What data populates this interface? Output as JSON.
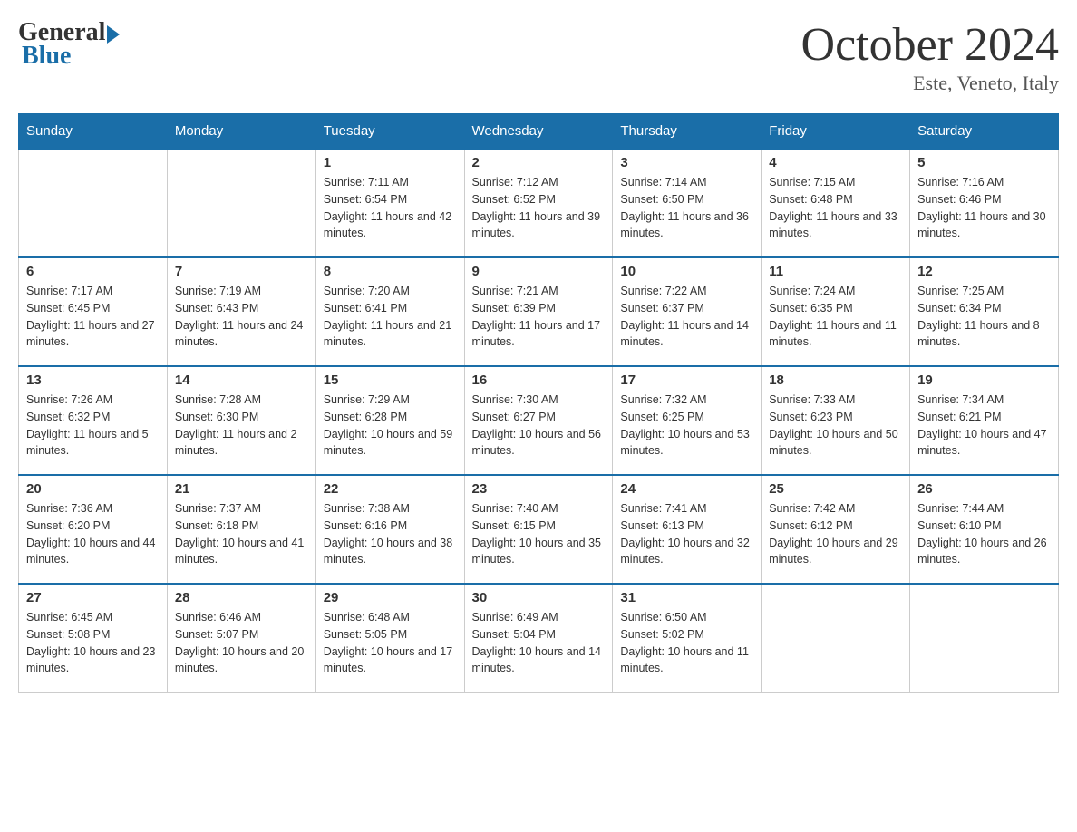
{
  "header": {
    "logo_general": "General",
    "logo_blue": "Blue",
    "month_title": "October 2024",
    "location": "Este, Veneto, Italy"
  },
  "days_of_week": [
    "Sunday",
    "Monday",
    "Tuesday",
    "Wednesday",
    "Thursday",
    "Friday",
    "Saturday"
  ],
  "weeks": [
    [
      {
        "day": "",
        "sunrise": "",
        "sunset": "",
        "daylight": ""
      },
      {
        "day": "",
        "sunrise": "",
        "sunset": "",
        "daylight": ""
      },
      {
        "day": "1",
        "sunrise": "Sunrise: 7:11 AM",
        "sunset": "Sunset: 6:54 PM",
        "daylight": "Daylight: 11 hours and 42 minutes."
      },
      {
        "day": "2",
        "sunrise": "Sunrise: 7:12 AM",
        "sunset": "Sunset: 6:52 PM",
        "daylight": "Daylight: 11 hours and 39 minutes."
      },
      {
        "day": "3",
        "sunrise": "Sunrise: 7:14 AM",
        "sunset": "Sunset: 6:50 PM",
        "daylight": "Daylight: 11 hours and 36 minutes."
      },
      {
        "day": "4",
        "sunrise": "Sunrise: 7:15 AM",
        "sunset": "Sunset: 6:48 PM",
        "daylight": "Daylight: 11 hours and 33 minutes."
      },
      {
        "day": "5",
        "sunrise": "Sunrise: 7:16 AM",
        "sunset": "Sunset: 6:46 PM",
        "daylight": "Daylight: 11 hours and 30 minutes."
      }
    ],
    [
      {
        "day": "6",
        "sunrise": "Sunrise: 7:17 AM",
        "sunset": "Sunset: 6:45 PM",
        "daylight": "Daylight: 11 hours and 27 minutes."
      },
      {
        "day": "7",
        "sunrise": "Sunrise: 7:19 AM",
        "sunset": "Sunset: 6:43 PM",
        "daylight": "Daylight: 11 hours and 24 minutes."
      },
      {
        "day": "8",
        "sunrise": "Sunrise: 7:20 AM",
        "sunset": "Sunset: 6:41 PM",
        "daylight": "Daylight: 11 hours and 21 minutes."
      },
      {
        "day": "9",
        "sunrise": "Sunrise: 7:21 AM",
        "sunset": "Sunset: 6:39 PM",
        "daylight": "Daylight: 11 hours and 17 minutes."
      },
      {
        "day": "10",
        "sunrise": "Sunrise: 7:22 AM",
        "sunset": "Sunset: 6:37 PM",
        "daylight": "Daylight: 11 hours and 14 minutes."
      },
      {
        "day": "11",
        "sunrise": "Sunrise: 7:24 AM",
        "sunset": "Sunset: 6:35 PM",
        "daylight": "Daylight: 11 hours and 11 minutes."
      },
      {
        "day": "12",
        "sunrise": "Sunrise: 7:25 AM",
        "sunset": "Sunset: 6:34 PM",
        "daylight": "Daylight: 11 hours and 8 minutes."
      }
    ],
    [
      {
        "day": "13",
        "sunrise": "Sunrise: 7:26 AM",
        "sunset": "Sunset: 6:32 PM",
        "daylight": "Daylight: 11 hours and 5 minutes."
      },
      {
        "day": "14",
        "sunrise": "Sunrise: 7:28 AM",
        "sunset": "Sunset: 6:30 PM",
        "daylight": "Daylight: 11 hours and 2 minutes."
      },
      {
        "day": "15",
        "sunrise": "Sunrise: 7:29 AM",
        "sunset": "Sunset: 6:28 PM",
        "daylight": "Daylight: 10 hours and 59 minutes."
      },
      {
        "day": "16",
        "sunrise": "Sunrise: 7:30 AM",
        "sunset": "Sunset: 6:27 PM",
        "daylight": "Daylight: 10 hours and 56 minutes."
      },
      {
        "day": "17",
        "sunrise": "Sunrise: 7:32 AM",
        "sunset": "Sunset: 6:25 PM",
        "daylight": "Daylight: 10 hours and 53 minutes."
      },
      {
        "day": "18",
        "sunrise": "Sunrise: 7:33 AM",
        "sunset": "Sunset: 6:23 PM",
        "daylight": "Daylight: 10 hours and 50 minutes."
      },
      {
        "day": "19",
        "sunrise": "Sunrise: 7:34 AM",
        "sunset": "Sunset: 6:21 PM",
        "daylight": "Daylight: 10 hours and 47 minutes."
      }
    ],
    [
      {
        "day": "20",
        "sunrise": "Sunrise: 7:36 AM",
        "sunset": "Sunset: 6:20 PM",
        "daylight": "Daylight: 10 hours and 44 minutes."
      },
      {
        "day": "21",
        "sunrise": "Sunrise: 7:37 AM",
        "sunset": "Sunset: 6:18 PM",
        "daylight": "Daylight: 10 hours and 41 minutes."
      },
      {
        "day": "22",
        "sunrise": "Sunrise: 7:38 AM",
        "sunset": "Sunset: 6:16 PM",
        "daylight": "Daylight: 10 hours and 38 minutes."
      },
      {
        "day": "23",
        "sunrise": "Sunrise: 7:40 AM",
        "sunset": "Sunset: 6:15 PM",
        "daylight": "Daylight: 10 hours and 35 minutes."
      },
      {
        "day": "24",
        "sunrise": "Sunrise: 7:41 AM",
        "sunset": "Sunset: 6:13 PM",
        "daylight": "Daylight: 10 hours and 32 minutes."
      },
      {
        "day": "25",
        "sunrise": "Sunrise: 7:42 AM",
        "sunset": "Sunset: 6:12 PM",
        "daylight": "Daylight: 10 hours and 29 minutes."
      },
      {
        "day": "26",
        "sunrise": "Sunrise: 7:44 AM",
        "sunset": "Sunset: 6:10 PM",
        "daylight": "Daylight: 10 hours and 26 minutes."
      }
    ],
    [
      {
        "day": "27",
        "sunrise": "Sunrise: 6:45 AM",
        "sunset": "Sunset: 5:08 PM",
        "daylight": "Daylight: 10 hours and 23 minutes."
      },
      {
        "day": "28",
        "sunrise": "Sunrise: 6:46 AM",
        "sunset": "Sunset: 5:07 PM",
        "daylight": "Daylight: 10 hours and 20 minutes."
      },
      {
        "day": "29",
        "sunrise": "Sunrise: 6:48 AM",
        "sunset": "Sunset: 5:05 PM",
        "daylight": "Daylight: 10 hours and 17 minutes."
      },
      {
        "day": "30",
        "sunrise": "Sunrise: 6:49 AM",
        "sunset": "Sunset: 5:04 PM",
        "daylight": "Daylight: 10 hours and 14 minutes."
      },
      {
        "day": "31",
        "sunrise": "Sunrise: 6:50 AM",
        "sunset": "Sunset: 5:02 PM",
        "daylight": "Daylight: 10 hours and 11 minutes."
      },
      {
        "day": "",
        "sunrise": "",
        "sunset": "",
        "daylight": ""
      },
      {
        "day": "",
        "sunrise": "",
        "sunset": "",
        "daylight": ""
      }
    ]
  ]
}
